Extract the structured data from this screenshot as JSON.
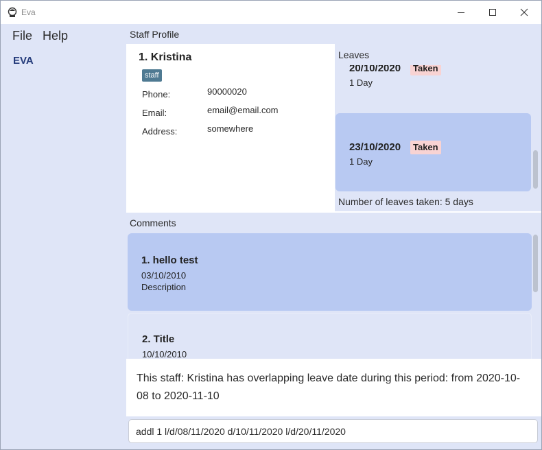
{
  "window": {
    "title": "Eva"
  },
  "menu": {
    "file": "File",
    "help": "Help"
  },
  "sidebar": {
    "brand": "EVA"
  },
  "profile": {
    "header": "Staff Profile",
    "name": "1.  Kristina",
    "tag": "staff",
    "fields": [
      {
        "label": "Phone:",
        "value": "90000020"
      },
      {
        "label": "Email:",
        "value": "email@email.com"
      },
      {
        "label": "Address:",
        "value": "somewhere"
      }
    ]
  },
  "leaves": {
    "header": "Leaves",
    "items": [
      {
        "date": "20/10/2020",
        "status": "Taken",
        "duration": "1 Day"
      },
      {
        "date": "23/10/2020",
        "status": "Taken",
        "duration": "1 Day"
      }
    ],
    "summary": "Number of leaves taken: 5 days"
  },
  "comments": {
    "header": "Comments",
    "items": [
      {
        "title": "1.  hello test",
        "date": "03/10/2010",
        "description": "Description"
      },
      {
        "title": "2.  Title",
        "date": "10/10/2010"
      }
    ]
  },
  "result": {
    "text": "This staff: Kristina has overlapping leave date during this period: from 2020-10-08 to 2020-11-10"
  },
  "command": {
    "value": "addl 1 l/d/08/11/2020 d/10/11/2020 l/d/20/11/2020"
  },
  "colors": {
    "panel_bg": "#dfe5f7",
    "card_selected": "#b8c9f2",
    "card_normal": "#dfe5f7",
    "tag_bg": "#4f7a92",
    "taken_bg": "#f8d3d3",
    "brand": "#233a7a"
  }
}
